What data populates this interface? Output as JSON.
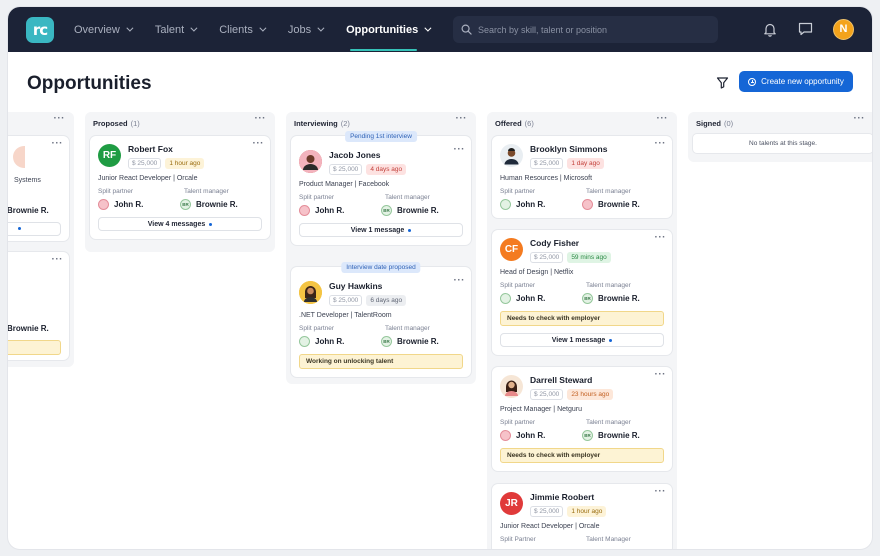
{
  "nav": {
    "logo": "rc",
    "menu": [
      {
        "label": "Overview",
        "active": false
      },
      {
        "label": "Talent",
        "active": false
      },
      {
        "label": "Clients",
        "active": false
      },
      {
        "label": "Jobs",
        "active": false
      },
      {
        "label": "Opportunities",
        "active": true
      }
    ],
    "search_placeholder": "Search by skill, talent or position",
    "user_initial": "N"
  },
  "header": {
    "title": "Opportunities",
    "create_label": "Create new opportunity"
  },
  "partial_column": {
    "card1": {
      "role_tail": "Systems",
      "talent_manager": "Brownie R."
    },
    "card2": {
      "talent_manager": "Brownie R."
    }
  },
  "columns": [
    {
      "name": "Proposed",
      "count": "(1)",
      "cards": [
        {
          "name": "Robert Fox",
          "initials": "RF",
          "rate": "$ 25,000",
          "ago": "1 hour ago",
          "role": "Junior React Developer | Orcale",
          "split_label": "Split partner",
          "tm_label": "Talent manager",
          "split": "John R.",
          "tm": "Brownie R.",
          "messages": "View 4 messages"
        }
      ]
    },
    {
      "name": "Interviewing",
      "count": "(2)",
      "cards": [
        {
          "tag": "Pending 1st interview",
          "name": "Jacob Jones",
          "rate": "$ 25,000",
          "ago": "4 days ago",
          "role": "Product Manager | Facebook",
          "split_label": "Split partner",
          "tm_label": "Talent manager",
          "split": "John R.",
          "tm": "Brownie R.",
          "messages": "View 1 message"
        },
        {
          "tag": "Interview date proposed",
          "name": "Guy Hawkins",
          "rate": "$ 25,000",
          "ago": "6 days ago",
          "role": ".NET Developer | TalentRoom",
          "split_label": "Split partner",
          "tm_label": "Talent manager",
          "split": "John R.",
          "tm": "Brownie R.",
          "note": "Working on unlocking talent"
        }
      ]
    },
    {
      "name": "Offered",
      "count": "(6)",
      "cards": [
        {
          "name": "Brooklyn Simmons",
          "rate": "$ 25,000",
          "ago": "1 day ago",
          "role": "Human Resources | Microsoft",
          "split_label": "Split partner",
          "tm_label": "Talent manager",
          "split": "John R.",
          "tm": "Brownie R."
        },
        {
          "name": "Cody Fisher",
          "initials": "CF",
          "rate": "$ 25,000",
          "ago": "59 mins ago",
          "role": "Head of Design | Netflix",
          "split_label": "Split partner",
          "tm_label": "Talent manager",
          "split": "John R.",
          "tm": "Brownie R.",
          "note": "Needs to check with employer",
          "messages": "View 1 message"
        },
        {
          "name": "Darrell Steward",
          "rate": "$ 25,000",
          "ago": "23 hours ago",
          "role": "Project Manager | Netguru",
          "split_label": "Split partner",
          "tm_label": "Talent manager",
          "split": "John R.",
          "tm": "Brownie R.",
          "note": "Needs to check with employer"
        },
        {
          "name": "Jimmie Roobert",
          "initials": "JR",
          "rate": "$ 25,000",
          "ago": "1 hour ago",
          "role": "Junior React Developer | Orcale",
          "split_label": "Split Partner",
          "tm_label": "Talent Manager"
        }
      ]
    },
    {
      "name": "Signed",
      "count": "(0)",
      "empty": "No talents at this stage."
    }
  ],
  "colors": {
    "nav_bg": "#1c2337",
    "accent": "#1566d6",
    "logo": "#3ab7c2"
  }
}
